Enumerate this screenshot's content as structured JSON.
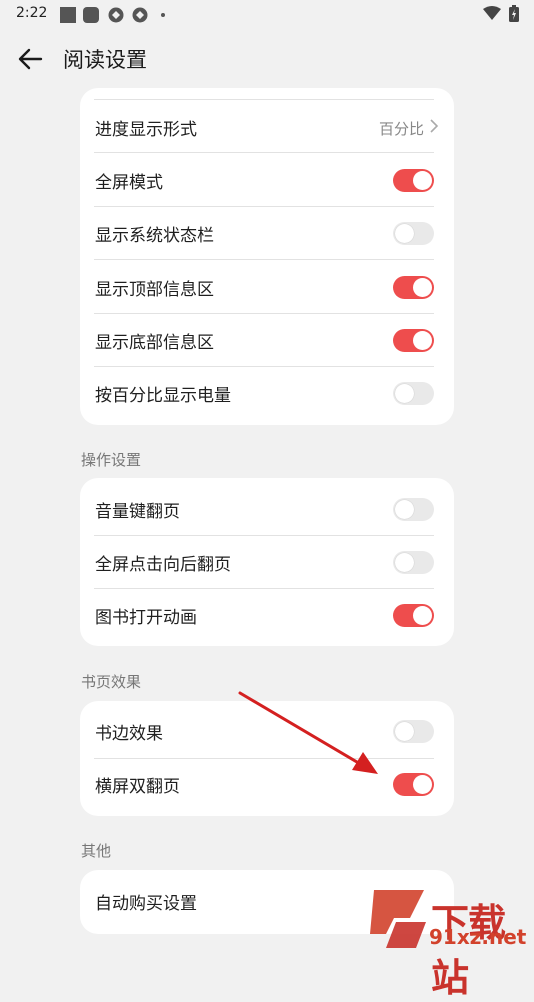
{
  "status_bar": {
    "time": "2:22",
    "icons": [
      "app-icon-square",
      "app-icon-rounded",
      "app-icon-circle",
      "app-icon-circle",
      "notification-dot",
      "wifi-icon",
      "battery-icon"
    ]
  },
  "header": {
    "title": "阅读设置",
    "back_icon": "arrow-left-icon"
  },
  "display_section": {
    "progress_display": {
      "label": "进度显示形式",
      "value": "百分比"
    },
    "fullscreen": {
      "label": "全屏模式",
      "on": true
    },
    "system_status_bar": {
      "label": "显示系统状态栏",
      "on": false
    },
    "top_info": {
      "label": "显示顶部信息区",
      "on": true
    },
    "bottom_info": {
      "label": "显示底部信息区",
      "on": true
    },
    "battery_percent": {
      "label": "按百分比显示电量",
      "on": false
    }
  },
  "operation_section": {
    "title": "操作设置",
    "volume_key_flip": {
      "label": "音量键翻页",
      "on": false
    },
    "fullscreen_tap_flip": {
      "label": "全屏点击向后翻页",
      "on": false
    },
    "open_animation": {
      "label": "图书打开动画",
      "on": true
    }
  },
  "page_effect_section": {
    "title": "书页效果",
    "book_edge": {
      "label": "书边效果",
      "on": false
    },
    "landscape_double": {
      "label": "横屏双翻页",
      "on": true
    }
  },
  "other_section": {
    "title": "其他",
    "auto_purchase": {
      "label": "自动购买设置"
    }
  },
  "watermark": {
    "text": "下载站",
    "url": "91xz.net"
  },
  "colors": {
    "accent": "#ee4d4d",
    "toggle_off": "#e9e9e9",
    "background": "#f1f1f1",
    "card": "#ffffff",
    "arrow": "#d42020"
  }
}
